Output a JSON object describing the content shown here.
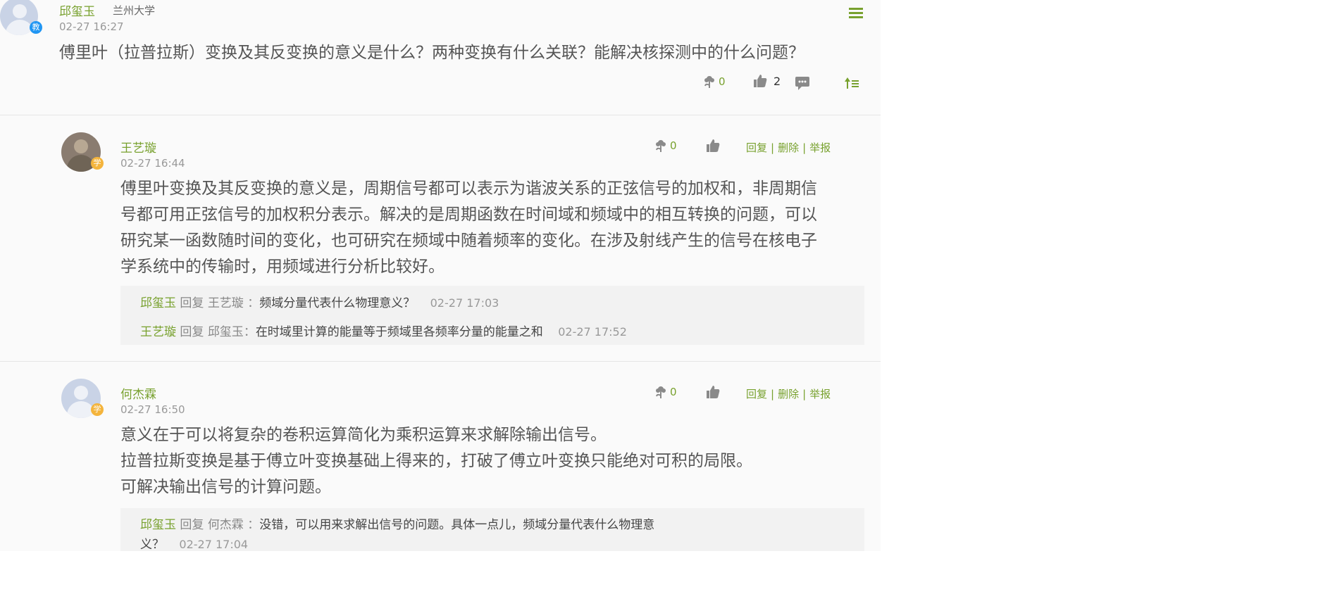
{
  "post": {
    "author": "邱玺玉",
    "school": "兰州大学",
    "role_badge": "教",
    "time": "02-27 16:27",
    "text": "傅里叶（拉普拉斯）变换及其反变换的意义是什么？两种变换有什么关联？能解决核探测中的什么问题？",
    "flower_count": "0",
    "like_count": "2",
    "icons": [
      "menu-icon",
      "flower-icon",
      "thumbs-up-icon",
      "comment-icon",
      "sort-top-icon"
    ]
  },
  "replies": [
    {
      "author": "王艺璇",
      "role_badge": "学",
      "time": "02-27 16:44",
      "flower_count": "0",
      "lines": [
        "傅里叶变换及其反变换的意义是，周期信号都可以表示为谐波关系的正弦信号的加权和，非周期信",
        "号都可用正弦信号的加权积分表示。解决的是周期函数在时间域和频域中的相互转换的问题，可以",
        "研究某一函数随时间的变化，也可研究在频域中随着频率的变化。在涉及射线产生的信号在核电子",
        "学系统中的传输时，用频域进行分析比较好。"
      ],
      "actions": {
        "reply": "回复",
        "delete": "删除",
        "report": "举报",
        "sep": "|"
      },
      "comments": [
        {
          "from": "邱玺玉",
          "verb": "回复",
          "to": "王艺璇",
          "colon": "：",
          "text": "频域分量代表什么物理意义？",
          "time": "02-27 17:03"
        },
        {
          "from": "王艺璇",
          "verb": "回复",
          "to": "邱玺玉",
          "colon": "：",
          "text": "在时域里计算的能量等于频域里各频率分量的能量之和",
          "time": "02-27 17:52"
        }
      ]
    },
    {
      "author": "何杰霖",
      "role_badge": "学",
      "time": "02-27 16:50",
      "flower_count": "0",
      "lines": [
        "意义在于可以将复杂的卷积运算简化为乘积运算来求解除输出信号。",
        "拉普拉斯变换是基于傅立叶变换基础上得来的，打破了傅立叶变换只能绝对可积的局限。",
        "可解决输出信号的计算问题。"
      ],
      "actions": {
        "reply": "回复",
        "delete": "删除",
        "report": "举报",
        "sep": "|"
      },
      "comments": [
        {
          "from": "邱玺玉",
          "verb": "回复",
          "to": "何杰霖",
          "colon": "：",
          "text": "没错，可以用来求解出信号的问题。具体一点儿，频域分量代表什么物理意",
          "text2": "义？",
          "time": "02-27 17:04"
        }
      ]
    }
  ],
  "colors": {
    "accent": "#78a12e",
    "teacher_badge": "#2196f3",
    "student_badge": "#f4b43c"
  }
}
